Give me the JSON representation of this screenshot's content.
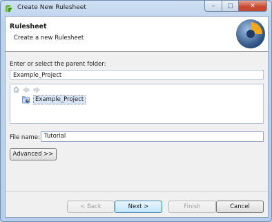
{
  "window": {
    "title": "Create New Rulesheet",
    "minimize": "–",
    "maximize": "□",
    "close": "✕"
  },
  "header": {
    "title": "Rulesheet",
    "description": "Create a new Rulesheet"
  },
  "parent_folder": {
    "label": "Enter or select the parent folder:",
    "value": "Example_Project",
    "tree_items": [
      "Example_Project"
    ]
  },
  "file_name": {
    "label": "File name:",
    "value": "Tutorial"
  },
  "buttons": {
    "advanced": "Advanced >>",
    "back": "< Back",
    "next": "Next >",
    "finish": "Finish",
    "cancel": "Cancel"
  }
}
